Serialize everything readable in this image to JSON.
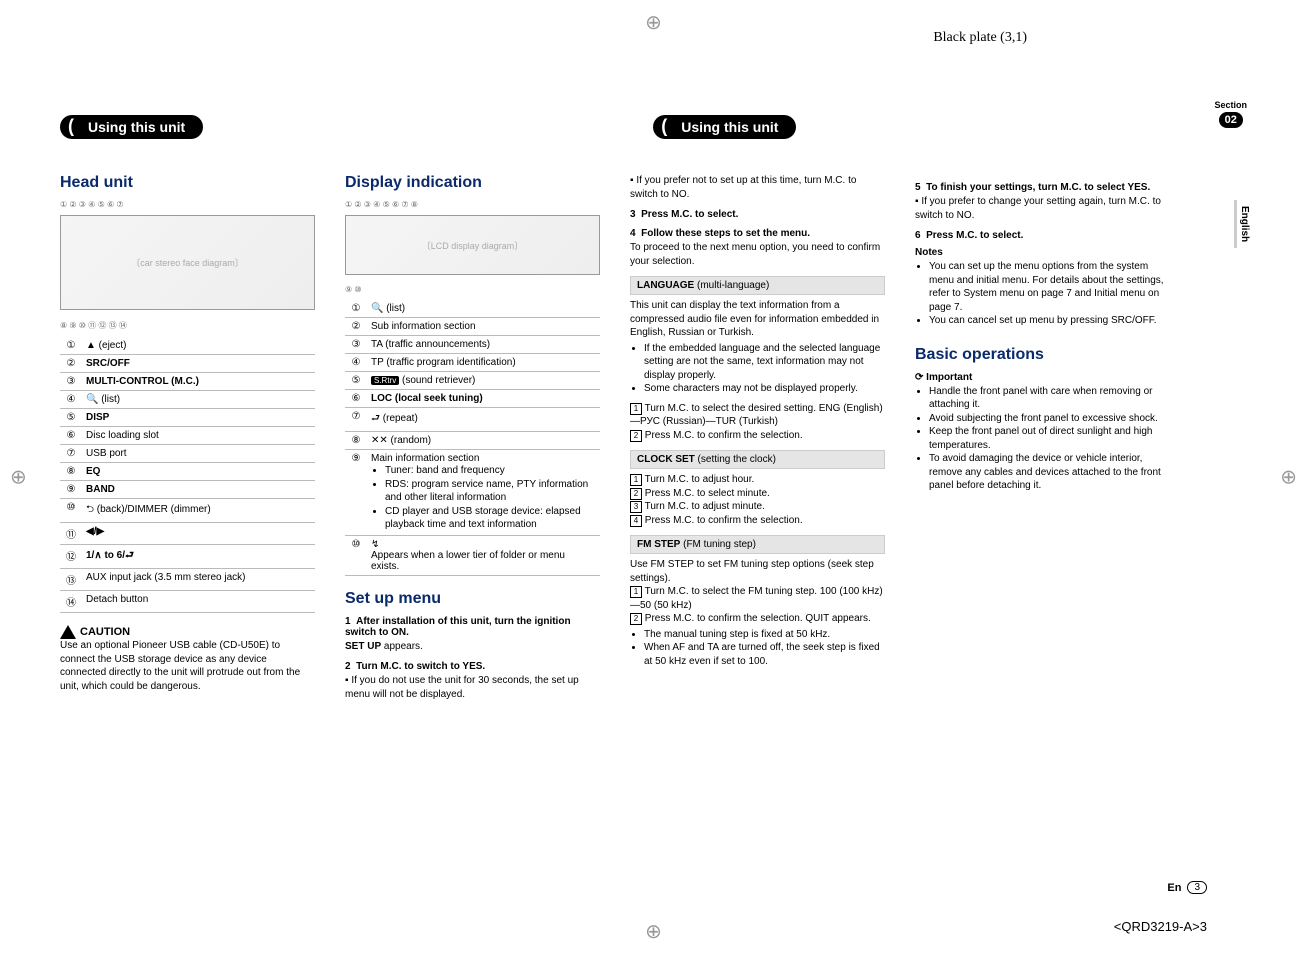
{
  "meta": {
    "black_plate": "Black plate (3,1)",
    "section_label": "Section",
    "section_num": "02",
    "language_tab": "English",
    "footer_lang": "En",
    "footer_page": "3",
    "doc_code": "<QRD3219-A>3"
  },
  "headers": {
    "left_pill": "Using this unit",
    "right_pill": "Using this unit"
  },
  "col1": {
    "title": "Head unit",
    "callouts_top": "① ② ③ ④ ⑤  ⑥        ⑦",
    "callouts_bot": "⑧ ⑨    ⑩   ⑪     ⑫    ⑬ ⑭",
    "legend": [
      {
        "n": "①",
        "t": "▲ (eject)"
      },
      {
        "n": "②",
        "t": "SRC/OFF",
        "bold": true
      },
      {
        "n": "③",
        "t": "MULTI-CONTROL (M.C.)",
        "bold": true
      },
      {
        "n": "④",
        "t": "🔍 (list)"
      },
      {
        "n": "⑤",
        "t": "DISP",
        "bold": true
      },
      {
        "n": "⑥",
        "t": "Disc loading slot"
      },
      {
        "n": "⑦",
        "t": "USB port"
      },
      {
        "n": "⑧",
        "t": "EQ",
        "bold": true
      },
      {
        "n": "⑨",
        "t": "BAND",
        "bold": true
      },
      {
        "n": "⑩",
        "t": "⮌ (back)/DIMMER (dimmer)"
      },
      {
        "n": "⑪",
        "t": "◀/▶",
        "bold": true
      },
      {
        "n": "⑫",
        "t": "1/∧ to 6/⮐",
        "bold": true
      },
      {
        "n": "⑬",
        "t": "AUX input jack (3.5 mm stereo jack)"
      },
      {
        "n": "⑭",
        "t": "Detach button"
      }
    ],
    "caution_label": "CAUTION",
    "caution_text": "Use an optional Pioneer USB cable (CD-U50E) to connect the USB storage device as any device connected directly to the unit will protrude out from the unit, which could be dangerous."
  },
  "col2": {
    "title": "Display indication",
    "callouts_top": "①      ②      ③ ④ ⑤ ⑥ ⑦ ⑧",
    "callouts_bot": "         ⑨              ⑩",
    "legend": [
      {
        "n": "①",
        "t": "🔍 (list)"
      },
      {
        "n": "②",
        "t": "Sub information section"
      },
      {
        "n": "③",
        "t": "TA (traffic announcements)"
      },
      {
        "n": "④",
        "t": "TP (traffic program identification)"
      },
      {
        "n": "⑤",
        "t": "[S.Rtrv] (sound retriever)"
      },
      {
        "n": "⑥",
        "t": "LOC (local seek tuning)",
        "bold": true
      },
      {
        "n": "⑦",
        "t": "⮐ (repeat)"
      },
      {
        "n": "⑧",
        "t": "✕✕ (random)"
      }
    ],
    "main_info_heading": "Main information section",
    "main_info_label": "⑨",
    "main_info_bullets": [
      "Tuner: band and frequency",
      "RDS: program service name, PTY information and other literal information",
      "CD player and USB storage device: elapsed playback time and text information"
    ],
    "row10_label": "⑩",
    "row10_icon": "↯",
    "row10_text": "Appears when a lower tier of folder or menu exists.",
    "setup_title": "Set up menu",
    "step1_num": "1",
    "step1": "After installation of this unit, turn the ignition switch to ON.",
    "step1_sub": "SET UP appears.",
    "step2_num": "2",
    "step2": "Turn M.C. to switch to YES.",
    "step2_note": "If you do not use the unit for 30 seconds, the set up menu will not be displayed."
  },
  "col3": {
    "intro_note": "If you prefer not to set up at this time, turn M.C. to switch to NO.",
    "step3_num": "3",
    "step3": "Press M.C. to select.",
    "step4_num": "4",
    "step4": "Follow these steps to set the menu.",
    "step4_sub": "To proceed to the next menu option, you need to confirm your selection.",
    "lang_box": "LANGUAGE (multi-language)",
    "lang_text": "This unit can display the text information from a compressed audio file even for information embedded in English, Russian or Turkish.",
    "lang_bullets": [
      "If the embedded language and the selected language setting are not the same, text information may not display properly.",
      "Some characters may not be displayed properly."
    ],
    "lang_steps": [
      "Turn M.C. to select the desired setting. ENG (English)—РУС (Russian)—TUR (Turkish)",
      "Press M.C. to confirm the selection."
    ],
    "clock_box": "CLOCK SET (setting the clock)",
    "clock_steps": [
      "Turn M.C. to adjust hour.",
      "Press M.C. to select minute.",
      "Turn M.C. to adjust minute.",
      "Press M.C. to confirm the selection."
    ],
    "fm_box": "FM STEP (FM tuning step)",
    "fm_text": "Use FM STEP to set FM tuning step options (seek step settings).",
    "fm_steps": [
      "Turn M.C. to select the FM tuning step. 100 (100 kHz)—50 (50 kHz)",
      "Press M.C. to confirm the selection. QUIT appears."
    ],
    "fm_bullets": [
      "The manual tuning step is fixed at 50 kHz.",
      "When AF and TA are turned off, the seek step is fixed at 50 kHz even if set to 100."
    ]
  },
  "col4": {
    "step5_num": "5",
    "step5": "To finish your settings, turn M.C. to select YES.",
    "step5_note": "If you prefer to change your setting again, turn M.C. to switch to NO.",
    "step6_num": "6",
    "step6": "Press M.C. to select.",
    "notes_label": "Notes",
    "notes": [
      "You can set up the menu options from the system menu and initial menu. For details about the settings, refer to System menu on page 7 and Initial menu on page 7.",
      "You can cancel set up menu by pressing SRC/OFF."
    ],
    "basic_title": "Basic operations",
    "important_label": "Important",
    "important_bullets": [
      "Handle the front panel with care when removing or attaching it.",
      "Avoid subjecting the front panel to excessive shock.",
      "Keep the front panel out of direct sunlight and high temperatures.",
      "To avoid damaging the device or vehicle interior, remove any cables and devices attached to the front panel before detaching it."
    ]
  }
}
